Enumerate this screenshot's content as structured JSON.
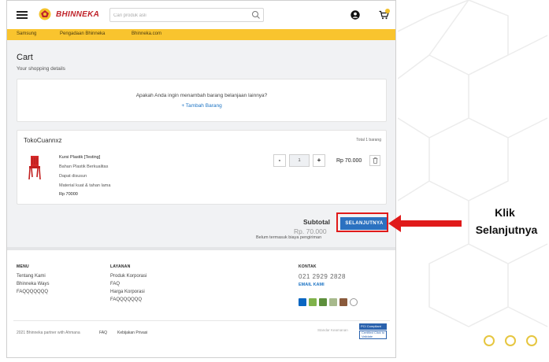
{
  "header": {
    "brand": "BHINNEKA",
    "search_placeholder": "Cari produk asli",
    "search_value": ""
  },
  "navbar": {
    "items": [
      "Samsung",
      "Pengadaan Bhinneka",
      "Bhinneka.com"
    ]
  },
  "cart": {
    "title": "Cart",
    "subtitle": "Your shopping details",
    "question": "Apakah Anda ingin menambah barang belanjaan lainnya?",
    "add_link": "+ Tambah Barang",
    "seller": "TokoCuannxz",
    "total_items": "Total 1 barang",
    "product": {
      "name": "Kursi Plastik [Testing]",
      "lines": [
        "Bahan Plastik Berkualitas",
        "Dapat disusun",
        "Material kuat & tahan lama"
      ],
      "price": "Rp 70000",
      "quantity": "1",
      "row_price": "Rp 70.000",
      "image_icon": "red-plastic-chair"
    },
    "subtotal_label": "Subtotal",
    "subtotal_value": "Rp. 70.000",
    "subtotal_note": "Belum termasuk biaya pengiriman",
    "next_button": "SELANJUTNYA"
  },
  "footer": {
    "menu_heading": "MENU",
    "menu_links": [
      "Tentang Kami",
      "Bhinneka Ways",
      "FAQQQQQQQ"
    ],
    "layanan_heading": "LAYANAN",
    "layanan_links": [
      "Produk Korporasi",
      "FAQ",
      "Harga Korporasi",
      "FAQQQQQQQ"
    ],
    "kontak_heading": "KONTAK",
    "phone": "021 2929 2828",
    "email_label": "EMAIL KAMI",
    "copyright": "2021 Bhinneka partner with Ahmana",
    "bottom_links": [
      "FAQ",
      "Kebijakan Privasi"
    ],
    "seal_label": "Standar Keamanan",
    "seal1_text": "PCI Compliant",
    "seal2_text": "Certified Click to Validate"
  },
  "annotation": {
    "line1": "Klik",
    "line2": "Selanjutnya"
  },
  "colors": {
    "brand_red": "#c0242b",
    "nav_yellow": "#f9c42e",
    "primary_blue": "#2b71c0",
    "highlight_red": "#e01a1a",
    "dot_yellow": "#e6c640"
  }
}
